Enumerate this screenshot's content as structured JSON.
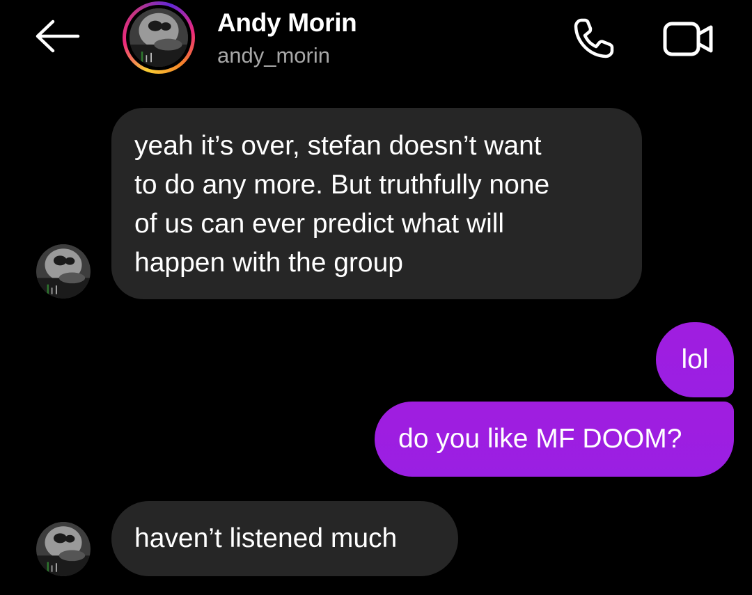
{
  "header": {
    "name": "Andy Morin",
    "handle": "andy_morin",
    "icons": {
      "back": "arrow-left-icon",
      "call": "phone-icon",
      "video": "video-camera-icon"
    }
  },
  "colors": {
    "background": "#000000",
    "received_bubble": "#262626",
    "sent_bubble": "#9b1fe0",
    "handle_text": "#a8a8a8"
  },
  "messages": [
    {
      "direction": "received",
      "lines": [
        "yeah it’s over, stefan doesn’t want",
        "to do any more. But truthfully none",
        "of us can ever predict what will",
        "happen with the group"
      ]
    },
    {
      "direction": "sent",
      "text": "lol"
    },
    {
      "direction": "sent",
      "text": "do you like MF DOOM?"
    },
    {
      "direction": "received",
      "text": "haven’t listened much"
    }
  ]
}
